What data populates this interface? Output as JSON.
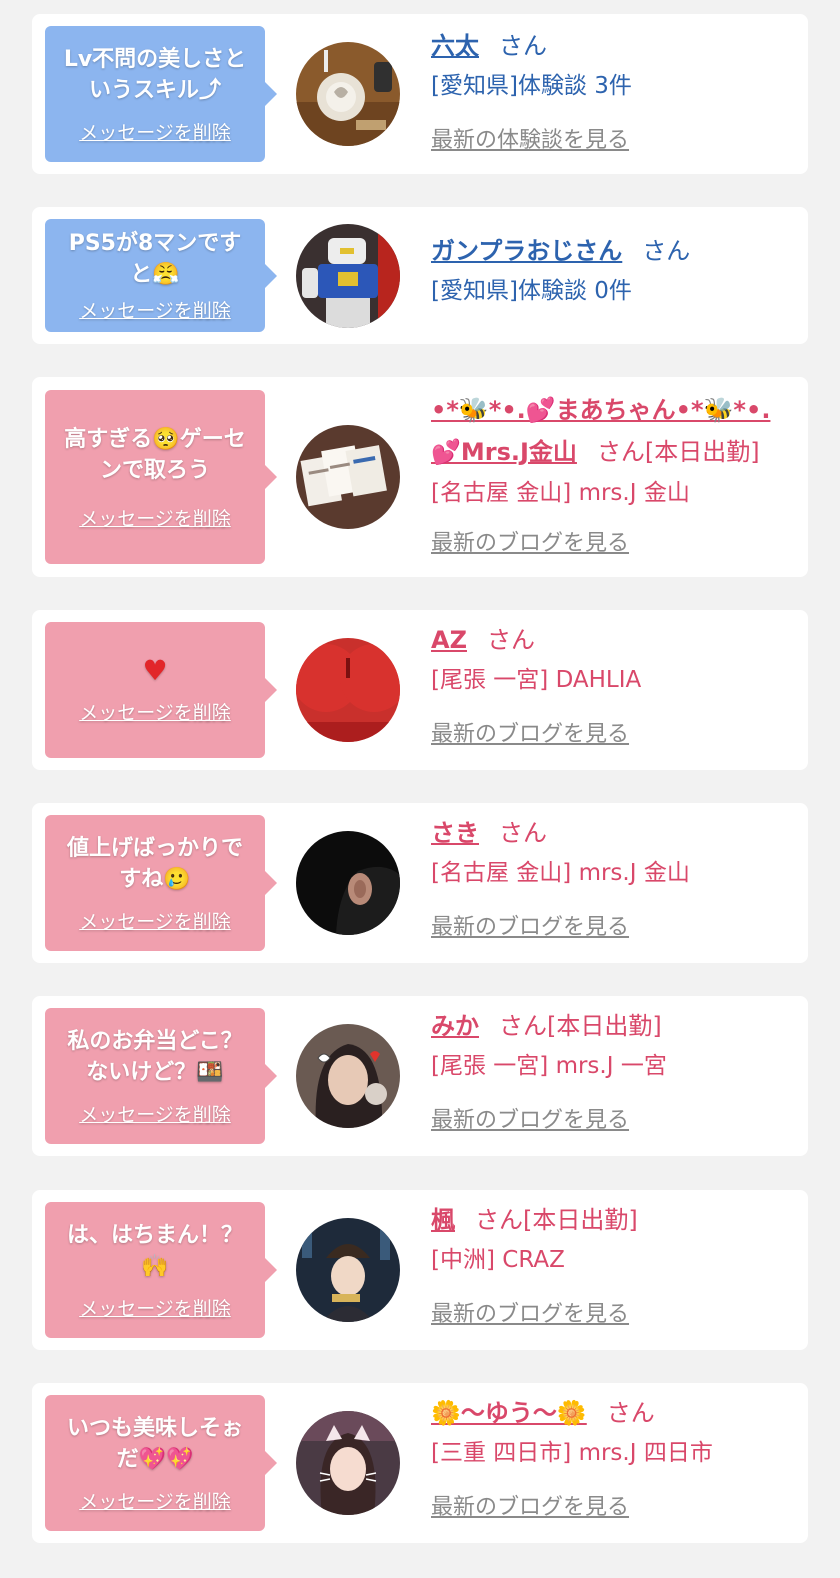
{
  "messages": [
    {
      "gender": "male",
      "bubble_lines": [
        "Lv不問の美しさと",
        "いうスキル⤴"
      ],
      "delete_label": "メッセージを削除",
      "name": "六太",
      "honorific": "さん",
      "shop": "[愛知県]体験談 3件",
      "link_label": "最新の体験談を見る"
    },
    {
      "gender": "male",
      "bubble_lines": [
        "PS5が8マンです",
        "と😤"
      ],
      "delete_label": "メッセージを削除",
      "name": "ガンプラおじさん",
      "honorific": "さん",
      "shop": "[愛知県]体験談 0件"
    },
    {
      "gender": "female",
      "bubble_lines": [
        "高すぎる🥺ゲーセ",
        "ンで取ろう"
      ],
      "delete_label": "メッセージを削除",
      "name_line1": "•*🐝*•.💕まあちゃん•*🐝*•.",
      "name_line2": "💕Mrs.J金山",
      "honorific": "さん[本日出勤]",
      "shop": "[名古屋 金山] mrs.J 金山",
      "link_label": "最新のブログを見る"
    },
    {
      "gender": "female",
      "bubble_lines": [
        "♥"
      ],
      "delete_label": "メッセージを削除",
      "name": "AZ",
      "honorific": "さん",
      "shop": "[尾張 一宮] DAHLIA",
      "link_label": "最新のブログを見る"
    },
    {
      "gender": "female",
      "bubble_lines": [
        "値上げばっかりで",
        "すね🥲"
      ],
      "delete_label": "メッセージを削除",
      "name": "さき",
      "honorific": "さん",
      "shop": "[名古屋 金山] mrs.J 金山",
      "link_label": "最新のブログを見る"
    },
    {
      "gender": "female",
      "bubble_lines": [
        "私のお弁当どこ？",
        "ないけど？🍱"
      ],
      "delete_label": "メッセージを削除",
      "name": "みか",
      "honorific": "さん[本日出勤]",
      "shop": "[尾張 一宮] mrs.J 一宮",
      "link_label": "最新のブログを見る"
    },
    {
      "gender": "female",
      "bubble_lines": [
        "は、はちまん！？",
        "🙌"
      ],
      "delete_label": "メッセージを削除",
      "name": "楓",
      "honorific": "さん[本日出勤]",
      "shop": "[中洲] CRAZ",
      "link_label": "最新のブログを見る"
    },
    {
      "gender": "female",
      "bubble_lines": [
        "いつも美味しそぉ",
        "だ💖💖"
      ],
      "delete_label": "メッセージを削除",
      "name": "🌼〜ゆう〜🌼",
      "honorific": "さん",
      "shop": "[三重 四日市] mrs.J 四日市",
      "link_label": "最新のブログを見る"
    }
  ],
  "colors": {
    "male_bubble": "#8cb5ef",
    "female_bubble": "#f09fae",
    "male_text": "#2d63ae",
    "female_text": "#d9486a",
    "link_gray": "#8a8a8a",
    "page_bg": "#f2f2f2"
  }
}
